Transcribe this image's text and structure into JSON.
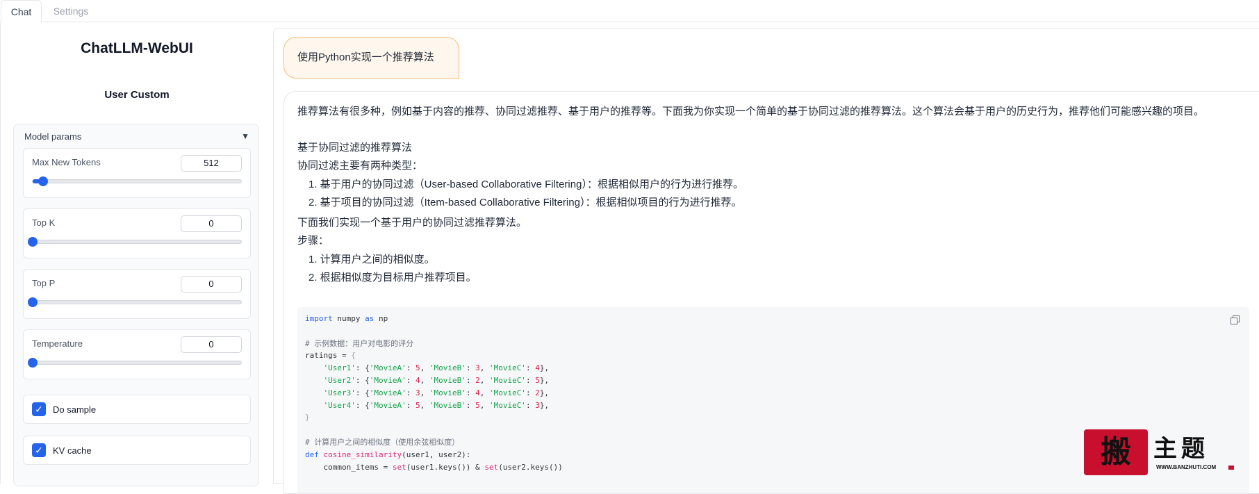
{
  "tabs": [
    {
      "label": "Chat"
    },
    {
      "label": "Settings"
    }
  ],
  "sidebar": {
    "app_title": "ChatLLM-WebUI",
    "section_title": "User Custom",
    "accordion_label": "Model params",
    "sliders": [
      {
        "label": "Max New Tokens",
        "value": "512",
        "fraction": 0.05
      },
      {
        "label": "Top K",
        "value": "0",
        "fraction": 0.0
      },
      {
        "label": "Top P",
        "value": "0",
        "fraction": 0.0
      },
      {
        "label": "Temperature",
        "value": "0",
        "fraction": 0.0
      }
    ],
    "checkboxes": [
      {
        "label": "Do sample",
        "checked": true
      },
      {
        "label": "KV cache",
        "checked": true
      }
    ]
  },
  "chat": {
    "user_message": "使用Python实现一个推荐算法",
    "bot": {
      "intro": "推荐算法有很多种，例如基于内容的推荐、协同过滤推荐、基于用户的推荐等。下面我为你实现一个简单的基于协同过滤的推荐算法。这个算法会基于用户的历史行为，推荐他们可能感兴趣的项目。",
      "heading": "基于协同过滤的推荐算法",
      "types_intro": "协同过滤主要有两种类型：",
      "types": [
        "1. 基于用户的协同过滤（User-based Collaborative Filtering）：根据相似用户的行为进行推荐。",
        "2. 基于项目的协同过滤（Item-based Collaborative Filtering）：根据相似项目的行为进行推荐。"
      ],
      "impl_intro": "下面我们实现一个基于用户的协同过滤推荐算法。",
      "steps_label": "步骤：",
      "steps": [
        "1. 计算用户之间的相似度。",
        "2. 根据相似度为目标用户推荐项目。"
      ]
    }
  },
  "code": {
    "import_kw": "import",
    "import_rest": " numpy ",
    "as_kw": "as",
    "np": " np",
    "comment1": "# 示例数据：用户对电影的评分",
    "ratings_assign": "ratings = ",
    "open_brace": "{",
    "rows": [
      {
        "user": "'User1'",
        "a": "5",
        "b": "3",
        "c": "4"
      },
      {
        "user": "'User2'",
        "a": "4",
        "b": "2",
        "c": "5"
      },
      {
        "user": "'User3'",
        "a": "3",
        "b": "4",
        "c": "2"
      },
      {
        "user": "'User4'",
        "a": "5",
        "b": "5",
        "c": "3"
      }
    ],
    "close_brace": "}",
    "comment2": "# 计算用户之间的相似度（使用余弦相似度）",
    "def_kw": "def",
    "func_name": "cosine_similarity",
    "func_args": "(user1, user2):",
    "line_common": "    common_items = ",
    "set_fn": "set",
    "common_rest1": "(user1.keys()) & ",
    "common_rest2": "(user2.keys())"
  },
  "watermark": {
    "stamp": "搬",
    "text": "主题",
    "url": "WWW.BANZHUTI.COM"
  },
  "colors": {
    "accent": "#2563eb",
    "user_bubble_bg": "#fff7ed",
    "user_bubble_border": "#fdba74"
  }
}
